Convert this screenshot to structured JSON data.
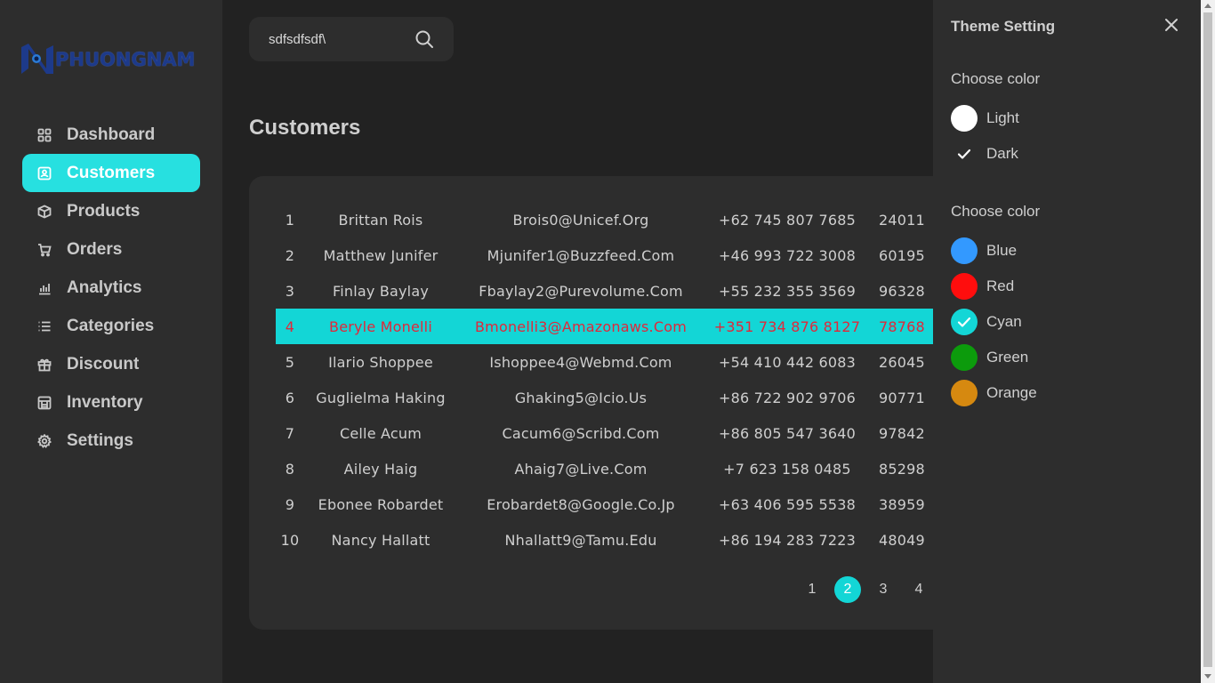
{
  "brand": {
    "logo_text": "PHUONGNAM"
  },
  "sidebar": {
    "items": [
      {
        "label": "Dashboard",
        "icon": "grid-icon"
      },
      {
        "label": "Customers",
        "icon": "contact-card-icon"
      },
      {
        "label": "Products",
        "icon": "box-icon"
      },
      {
        "label": "Orders",
        "icon": "cart-icon"
      },
      {
        "label": "Analytics",
        "icon": "bar-chart-icon"
      },
      {
        "label": "Categories",
        "icon": "list-icon"
      },
      {
        "label": "Discount",
        "icon": "gift-icon"
      },
      {
        "label": "Inventory",
        "icon": "warehouse-icon"
      },
      {
        "label": "Settings",
        "icon": "gear-icon"
      }
    ],
    "active": "Customers"
  },
  "search": {
    "value": "sdfsdfsdf\\",
    "placeholder": ""
  },
  "page": {
    "title": "Customers"
  },
  "customers": {
    "rows": [
      {
        "id": "1",
        "name": "Brittan Rois",
        "email": "Brois0@Unicef.Org",
        "phone": "+62 745 807 7685",
        "zip": "24011"
      },
      {
        "id": "2",
        "name": "Matthew Junifer",
        "email": "Mjunifer1@Buzzfeed.Com",
        "phone": "+46 993 722 3008",
        "zip": "60195"
      },
      {
        "id": "3",
        "name": "Finlay Baylay",
        "email": "Fbaylay2@Purevolume.Com",
        "phone": "+55 232 355 3569",
        "zip": "96328"
      },
      {
        "id": "4",
        "name": "Beryle Monelli",
        "email": "Bmonelli3@Amazonaws.Com",
        "phone": "+351 734 876 8127",
        "zip": "78768"
      },
      {
        "id": "5",
        "name": "Ilario Shoppee",
        "email": "Ishoppee4@Webmd.Com",
        "phone": "+54 410 442 6083",
        "zip": "26045"
      },
      {
        "id": "6",
        "name": "Guglielma Haking",
        "email": "Ghaking5@Icio.Us",
        "phone": "+86 722 902 9706",
        "zip": "90771"
      },
      {
        "id": "7",
        "name": "Celle Acum",
        "email": "Cacum6@Scribd.Com",
        "phone": "+86 805 547 3640",
        "zip": "97842"
      },
      {
        "id": "8",
        "name": "Ailey Haig",
        "email": "Ahaig7@Live.Com",
        "phone": "+7 623 158 0485",
        "zip": "85298"
      },
      {
        "id": "9",
        "name": "Ebonee Robardet",
        "email": "Erobardet8@Google.Co.Jp",
        "phone": "+63 406 595 5538",
        "zip": "38959"
      },
      {
        "id": "10",
        "name": "Nancy Hallatt",
        "email": "Nhallatt9@Tamu.Edu",
        "phone": "+86 194 283 7223",
        "zip": "48049"
      }
    ],
    "selected_row": "4",
    "pagination": {
      "pages": [
        "1",
        "2",
        "3",
        "4"
      ],
      "current": "2"
    }
  },
  "theme_panel": {
    "title": "Theme Setting",
    "mode_label": "Choose color",
    "modes": [
      {
        "label": "Light",
        "color": "#ffffff"
      },
      {
        "label": "Dark",
        "color": ""
      }
    ],
    "selected_mode": "Dark",
    "color_label": "Choose color",
    "colors": [
      {
        "label": "Blue",
        "color": "#3399ff"
      },
      {
        "label": "Red",
        "color": "#ff0d0d"
      },
      {
        "label": "Cyan",
        "color": "#13d6d6"
      },
      {
        "label": "Green",
        "color": "#0c9b0c"
      },
      {
        "label": "Orange",
        "color": "#d68910"
      }
    ],
    "selected_color": "Cyan"
  },
  "colors": {
    "accent": "#27e0e0",
    "selected_row_bg": "#13d6d6",
    "selected_row_text": "#e0283a",
    "bg": "#222222",
    "panel": "#2d2d2d"
  }
}
